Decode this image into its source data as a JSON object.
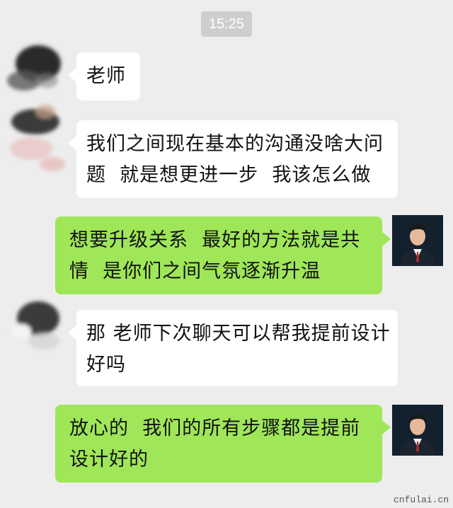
{
  "chat": {
    "timestamp": "15:25",
    "messages": [
      {
        "side": "in",
        "text": "老师"
      },
      {
        "side": "in",
        "text": "我们之间现在基本的沟通没啥大问\n题  就是想更进一步  我该怎么做"
      },
      {
        "side": "out",
        "text": "想要升级关系  最好的方法就是共\n情  是你们之间气氛逐渐升温"
      },
      {
        "side": "in",
        "text": "那 老师下次聊天可以帮我提前设计\n好吗"
      },
      {
        "side": "out",
        "text": "放心的  我们的所有步骤都是提前\n设计好的"
      }
    ]
  },
  "watermark": "cnfulai.cn",
  "colors": {
    "background": "#ededed",
    "incoming_bubble": "#ffffff",
    "outgoing_bubble": "#9fe658",
    "timestamp_bg": "#cecece"
  }
}
